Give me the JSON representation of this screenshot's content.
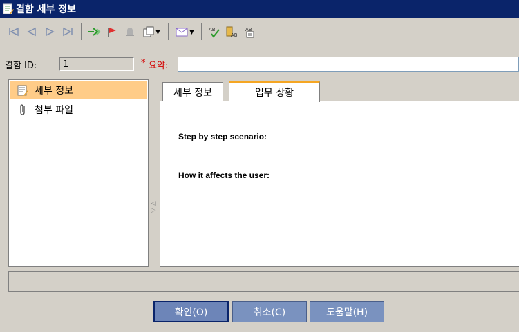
{
  "window": {
    "title": "결함 세부 정보",
    "title_icon": "defect-details-icon"
  },
  "toolbar": {
    "buttons": [
      {
        "name": "first-record-icon"
      },
      {
        "name": "previous-record-icon"
      },
      {
        "name": "next-record-icon"
      },
      {
        "name": "last-record-icon"
      },
      {
        "name": "go-to-defect-icon"
      },
      {
        "name": "flag-icon"
      },
      {
        "name": "alert-bell-icon"
      },
      {
        "name": "copy-icon",
        "dropdown": true
      },
      {
        "name": "email-icon",
        "dropdown": true
      },
      {
        "name": "spell-check-icon"
      },
      {
        "name": "thesaurus-icon"
      },
      {
        "name": "spelling-options-icon"
      }
    ]
  },
  "fields": {
    "id_label": "결함 ID:",
    "id_value": "1",
    "required_marker": "*",
    "summary_label": "요약:",
    "summary_value": ""
  },
  "nav": {
    "items": [
      {
        "label": "세부 정보",
        "icon": "details-icon",
        "selected": true
      },
      {
        "label": "첨부 파일",
        "icon": "paperclip-icon",
        "selected": false
      }
    ]
  },
  "tabs": [
    {
      "label": "세부 정보",
      "active": false
    },
    {
      "label": "업무 상황",
      "active": true
    }
  ],
  "content": {
    "line1": "Step by step scenario:",
    "line2": "How it affects the user:"
  },
  "buttons": {
    "ok": "확인(O)",
    "cancel": "취소(C)",
    "help": "도움말(H)"
  },
  "colors": {
    "title_bar": "#0a246a",
    "selected_nav": "#ffcc88",
    "active_tab_accent": "#f5a623",
    "button": "#7a92bf",
    "required": "#d40000"
  }
}
